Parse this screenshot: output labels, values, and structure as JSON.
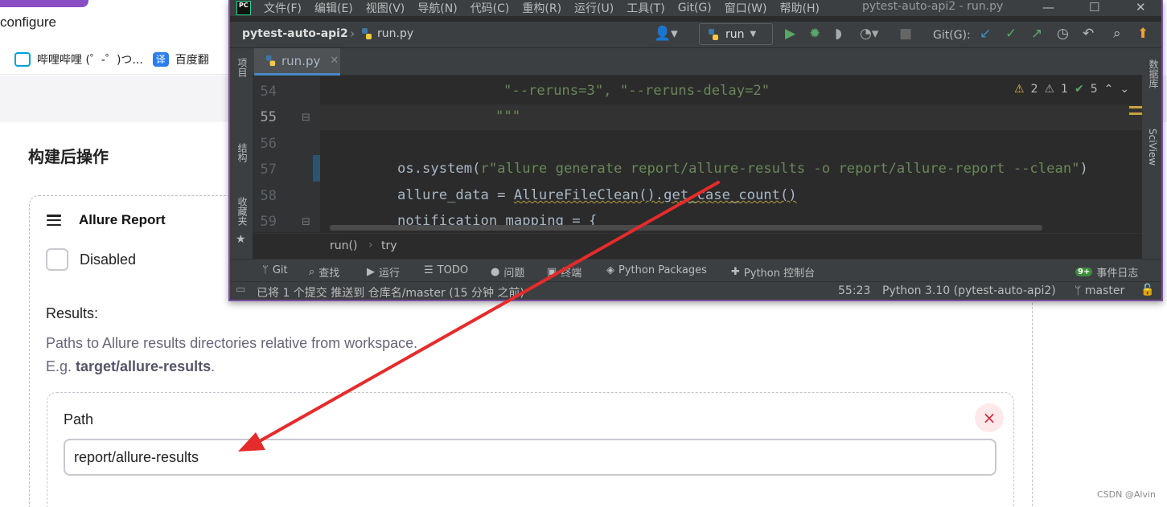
{
  "browser": {
    "url_fragment": "configure",
    "bookmarks": [
      {
        "label": "哔哩哔哩 (゜-゜)つ...",
        "icon": "bilibili-icon"
      },
      {
        "label": "百度翻",
        "icon": "translate-icon"
      }
    ]
  },
  "jenkins": {
    "section_title": "构建后操作",
    "card_title": "Allure Report",
    "disabled_label": "Disabled",
    "results_label": "Results:",
    "results_desc_line1": "Paths to Allure results directories relative from workspace.",
    "results_desc_prefix": "E.g. ",
    "results_desc_example": "target/allure-results",
    "results_desc_suffix": ".",
    "path_label": "Path",
    "path_value": "report/allure-results",
    "remove_icon": "×"
  },
  "ide": {
    "menu": [
      "文件(F)",
      "编辑(E)",
      "视图(V)",
      "导航(N)",
      "代码(C)",
      "重构(R)",
      "运行(U)",
      "工具(T)",
      "Git(G)",
      "窗口(W)",
      "帮助(H)"
    ],
    "window_title": "pytest-auto-api2 - run.py",
    "project_name": "pytest-auto-api2",
    "file_name": "run.py",
    "run_config": "run",
    "git_label": "Git(G):",
    "tab_name": "run.py",
    "left_strip": [
      "项目",
      "结构",
      "收藏夹"
    ],
    "right_strip": [
      "数据库",
      "SciView"
    ],
    "lines": [
      {
        "num": "54",
        "code_str": "\"--reruns=3\", \"--reruns-delay=2\""
      },
      {
        "num": "55",
        "code_str": "\"\"\""
      },
      {
        "num": "56"
      },
      {
        "num": "57",
        "code_a": "os.system(",
        "code_str": "r\"allure generate report/allure-results -o report/allure-report --clean\"",
        "code_b": ")"
      },
      {
        "num": "58",
        "code_a": "allure_data = ",
        "code_warn": "AllureFileClean().get_case_count()"
      },
      {
        "num": "59",
        "code_a": "notification_mapping = {"
      }
    ],
    "inspections": {
      "warnings": "2",
      "weak_warnings": "1",
      "ok": "5"
    },
    "breadcrumb_fn": "run()",
    "breadcrumb_block": "try",
    "tool_windows": [
      "Git",
      "查找",
      "运行",
      "TODO",
      "问题",
      "终端",
      "Python Packages",
      "Python 控制台"
    ],
    "event_log": "事件日志",
    "event_badge": "9+",
    "status_message": "已将 1 个提交 推送到 仓库名/master (15 分钟 之前)",
    "caret_position": "55:23",
    "interpreter": "Python 3.10 (pytest-auto-api2)",
    "branch": "master"
  },
  "watermark": "CSDN @Alvin",
  "colors": {
    "annotation_arrow": "#e52b2b",
    "ide_bg": "#2b2b2b",
    "ide_panel": "#3c3f41",
    "string": "#6a8759",
    "accent_purple": "#7b4f9e"
  }
}
